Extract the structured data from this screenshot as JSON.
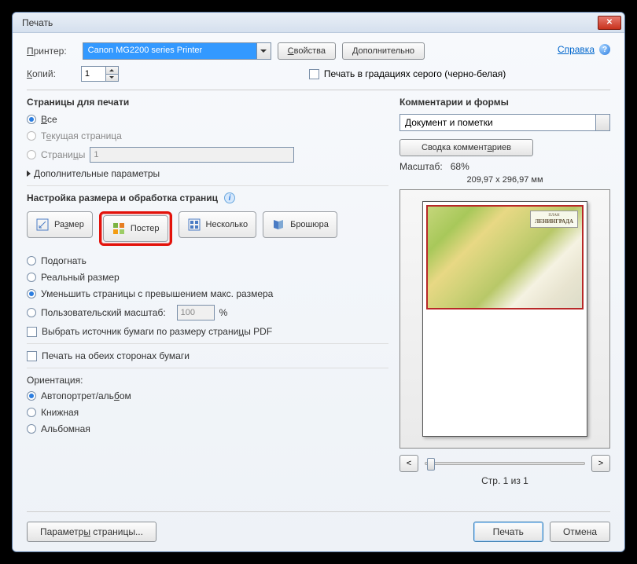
{
  "window": {
    "title": "Печать"
  },
  "top": {
    "printer_label": "Принтер:",
    "printer_value": "Canon MG2200 series Printer",
    "properties_btn": "Свойства",
    "advanced_btn": "Дополнительно",
    "help_link": "Справка",
    "copies_label": "Копий:",
    "copies_value": "1",
    "grayscale_label": "Печать в градациях серого (черно-белая)"
  },
  "pages": {
    "title": "Страницы для печати",
    "all": "Все",
    "current": "Текущая страница",
    "range_label": "Страницы",
    "range_value": "1",
    "more": "Дополнительные параметры"
  },
  "sizing": {
    "title": "Настройка размера и обработка страниц",
    "size_btn": "Размер",
    "poster_btn": "Постер",
    "multiple_btn": "Несколько",
    "booklet_btn": "Брошюра",
    "fit": "Подогнать",
    "actual": "Реальный размер",
    "shrink": "Уменьшить страницы с превышением макс. размера",
    "custom": "Пользовательский масштаб:",
    "custom_value": "100",
    "pct": "%",
    "paper_src": "Выбрать источник бумаги по размеру страницы PDF",
    "duplex": "Печать на обеих сторонах бумаги",
    "orientation_label": "Ориентация:",
    "auto": "Автопортрет/альбом",
    "portrait": "Книжная",
    "landscape": "Альбомная"
  },
  "right": {
    "comments_title": "Комментарии и формы",
    "comments_value": "Документ и пометки",
    "summary_btn": "Сводка комментариев",
    "scale_label": "Масштаб:",
    "scale_value": "68%",
    "paper_dims": "209,97 x 296,97 мм",
    "map_title_1": "ПЛАН",
    "map_title_2": "ЛЕНИНГРАДА",
    "page_label": "Стр. 1 из 1"
  },
  "footer": {
    "page_setup": "Параметры страницы...",
    "print": "Печать",
    "cancel": "Отмена"
  }
}
